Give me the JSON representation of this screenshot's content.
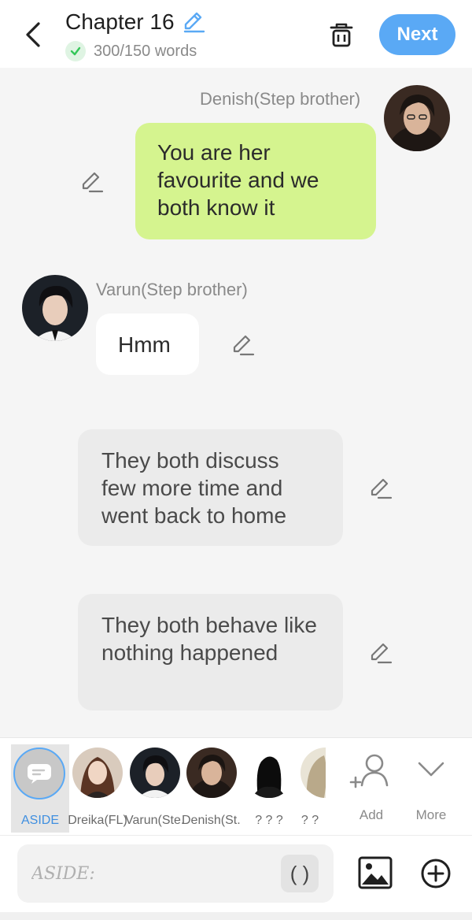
{
  "header": {
    "title": "Chapter 16",
    "word_count": "300/150 words",
    "next_label": "Next"
  },
  "messages": [
    {
      "speaker": "Denish(Step brother)",
      "text": "You are her favourite and we both know it"
    },
    {
      "speaker": "Varun(Step brother)",
      "text": "Hmm"
    },
    {
      "narration": "They both discuss few more time and went back to home"
    },
    {
      "narration": "They both behave like nothing happened"
    }
  ],
  "characters": {
    "aside_label": "ASIDE",
    "items": [
      {
        "label": "Dreika(FL)"
      },
      {
        "label": "Varun(Ste..."
      },
      {
        "label": "Denish(St..."
      },
      {
        "label": "? ? ?"
      },
      {
        "label": "? ?"
      }
    ],
    "add_label": "Add",
    "more_label": "More"
  },
  "composer": {
    "placeholder": "ASIDE:",
    "paren_label": "( )"
  },
  "colors": {
    "accent": "#5aa9f5",
    "green_bubble": "#d5f48f",
    "check": "#34c759"
  }
}
